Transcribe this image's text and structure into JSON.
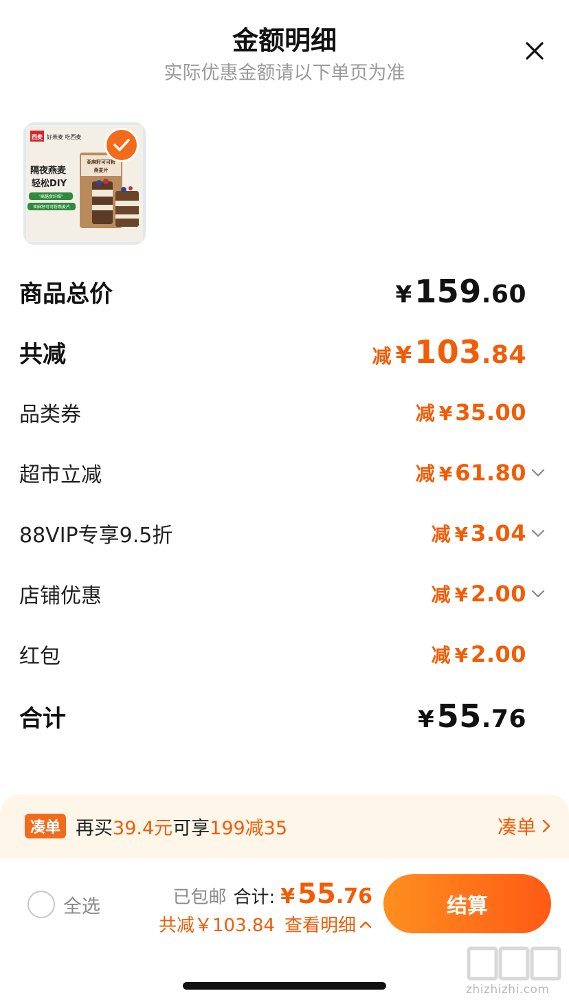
{
  "header": {
    "title": "金额明细",
    "subtitle": "实际优惠金额请以下单页为准"
  },
  "product": {
    "image_texts": {
      "brand": "西麦",
      "tagline": "好燕麦 吃西麦",
      "headline_1": "隔夜燕麦",
      "headline_2": "轻松DIY",
      "chip_1": "\"高膳食纤维\"",
      "chip_2": "亚麻籽可可粉燕麦片",
      "bag_title_1": "亚麻籽可可粉",
      "bag_title_2": "燕麦片"
    },
    "selected": true
  },
  "breakdown": {
    "subtotal": {
      "label": "商品总价",
      "yen": "¥",
      "int": "159",
      "dec": ".60"
    },
    "total_discount": {
      "label": "共减",
      "prefix": "减",
      "yen": "¥",
      "int": "103",
      "dec": ".84"
    },
    "items": [
      {
        "label": "品类券",
        "prefix": "减",
        "yen": "¥",
        "amount": "35.00",
        "expandable": false
      },
      {
        "label": "超市立减",
        "prefix": "减",
        "yen": "¥",
        "amount": "61.80",
        "expandable": true
      },
      {
        "label": "88VIP专享9.5折",
        "prefix": "减",
        "yen": "¥",
        "amount": "3.04",
        "expandable": true
      },
      {
        "label": "店铺优惠",
        "prefix": "减",
        "yen": "¥",
        "amount": "2.00",
        "expandable": true
      },
      {
        "label": "红包",
        "prefix": "减",
        "yen": "¥",
        "amount": "2.00",
        "expandable": false
      }
    ],
    "grand_total": {
      "label": "合计",
      "yen": "¥",
      "int": "55",
      "dec": ".76"
    }
  },
  "promo": {
    "tag": "凑单",
    "text_1": "再买",
    "highlight_1": "39.4元",
    "text_2": "可享",
    "highlight_2": "199减35",
    "link_label": "凑单"
  },
  "footer": {
    "select_all_label": "全选",
    "free_shipping": "已包邮",
    "total_label": "合计:",
    "total_yen": "¥",
    "total_int": "55",
    "total_dec": ".76",
    "saved_text": "共减￥103.84",
    "detail_link": "查看明细",
    "checkout_label": "结算"
  },
  "watermark": {
    "text": "zhizhizhi.com"
  },
  "colors": {
    "accent": "#f25c05",
    "button_start": "#ff8f1f",
    "button_end": "#ff5a14",
    "promo_bg": "#fff6ea"
  }
}
